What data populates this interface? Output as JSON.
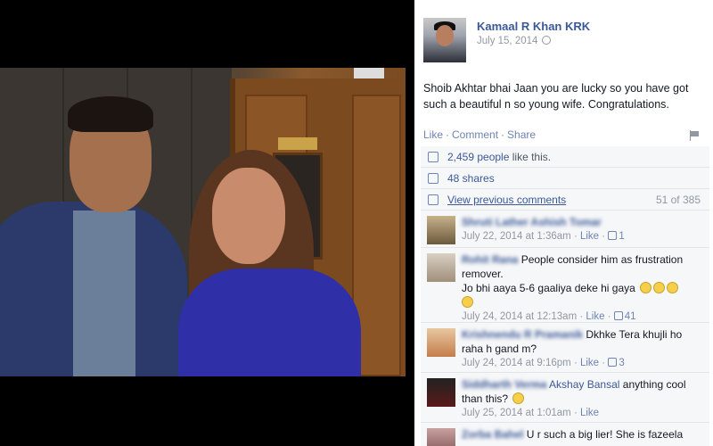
{
  "post": {
    "author": "Kamaal R Khan KRK",
    "date": "July 15, 2014",
    "text": "Shoib Akhtar bhai Jaan you are lucky so you have got such a beautiful n so young wife. Congratulations.",
    "actions": {
      "like": "Like",
      "comment": "Comment",
      "share": "Share",
      "separator": "·"
    }
  },
  "ufi": {
    "likes": {
      "count": "2,459 people",
      "suffix": " like this."
    },
    "shares": "48 shares",
    "previous_comments": "View previous comments",
    "comment_count": "51 of 385"
  },
  "comments": [
    {
      "name": "Shruti Lather Ashish Tomar",
      "text": "",
      "meta": "July 22, 2014 at 1:36am",
      "like": "Like",
      "likes": "1"
    },
    {
      "name": "Rohit Rana",
      "text": "People consider him as frustration remover.",
      "text2": "Jo bhi aaya 5-6 gaaliya deke hi gaya",
      "meta": "July 24, 2014 at 12:13am",
      "like": "Like",
      "likes": "41"
    },
    {
      "name": "Krishnendu R Pramanik",
      "text": "Dkhke Tera khujli ho raha h gand m?",
      "meta": "July 24, 2014 at 9:16pm",
      "like": "Like",
      "likes": "3"
    },
    {
      "name": "Siddharth Verma",
      "tag": "Akshay Bansal",
      "text": "anything cool than this?",
      "meta": "July 25, 2014 at 1:01am",
      "like": "Like"
    },
    {
      "name": "Zorba Bahel",
      "text": "U r such a big lier! She is fazeela"
    }
  ],
  "colors": {
    "link": "#3b5998",
    "meta": "#9197a3",
    "panel_bg": "#f6f7f8"
  }
}
